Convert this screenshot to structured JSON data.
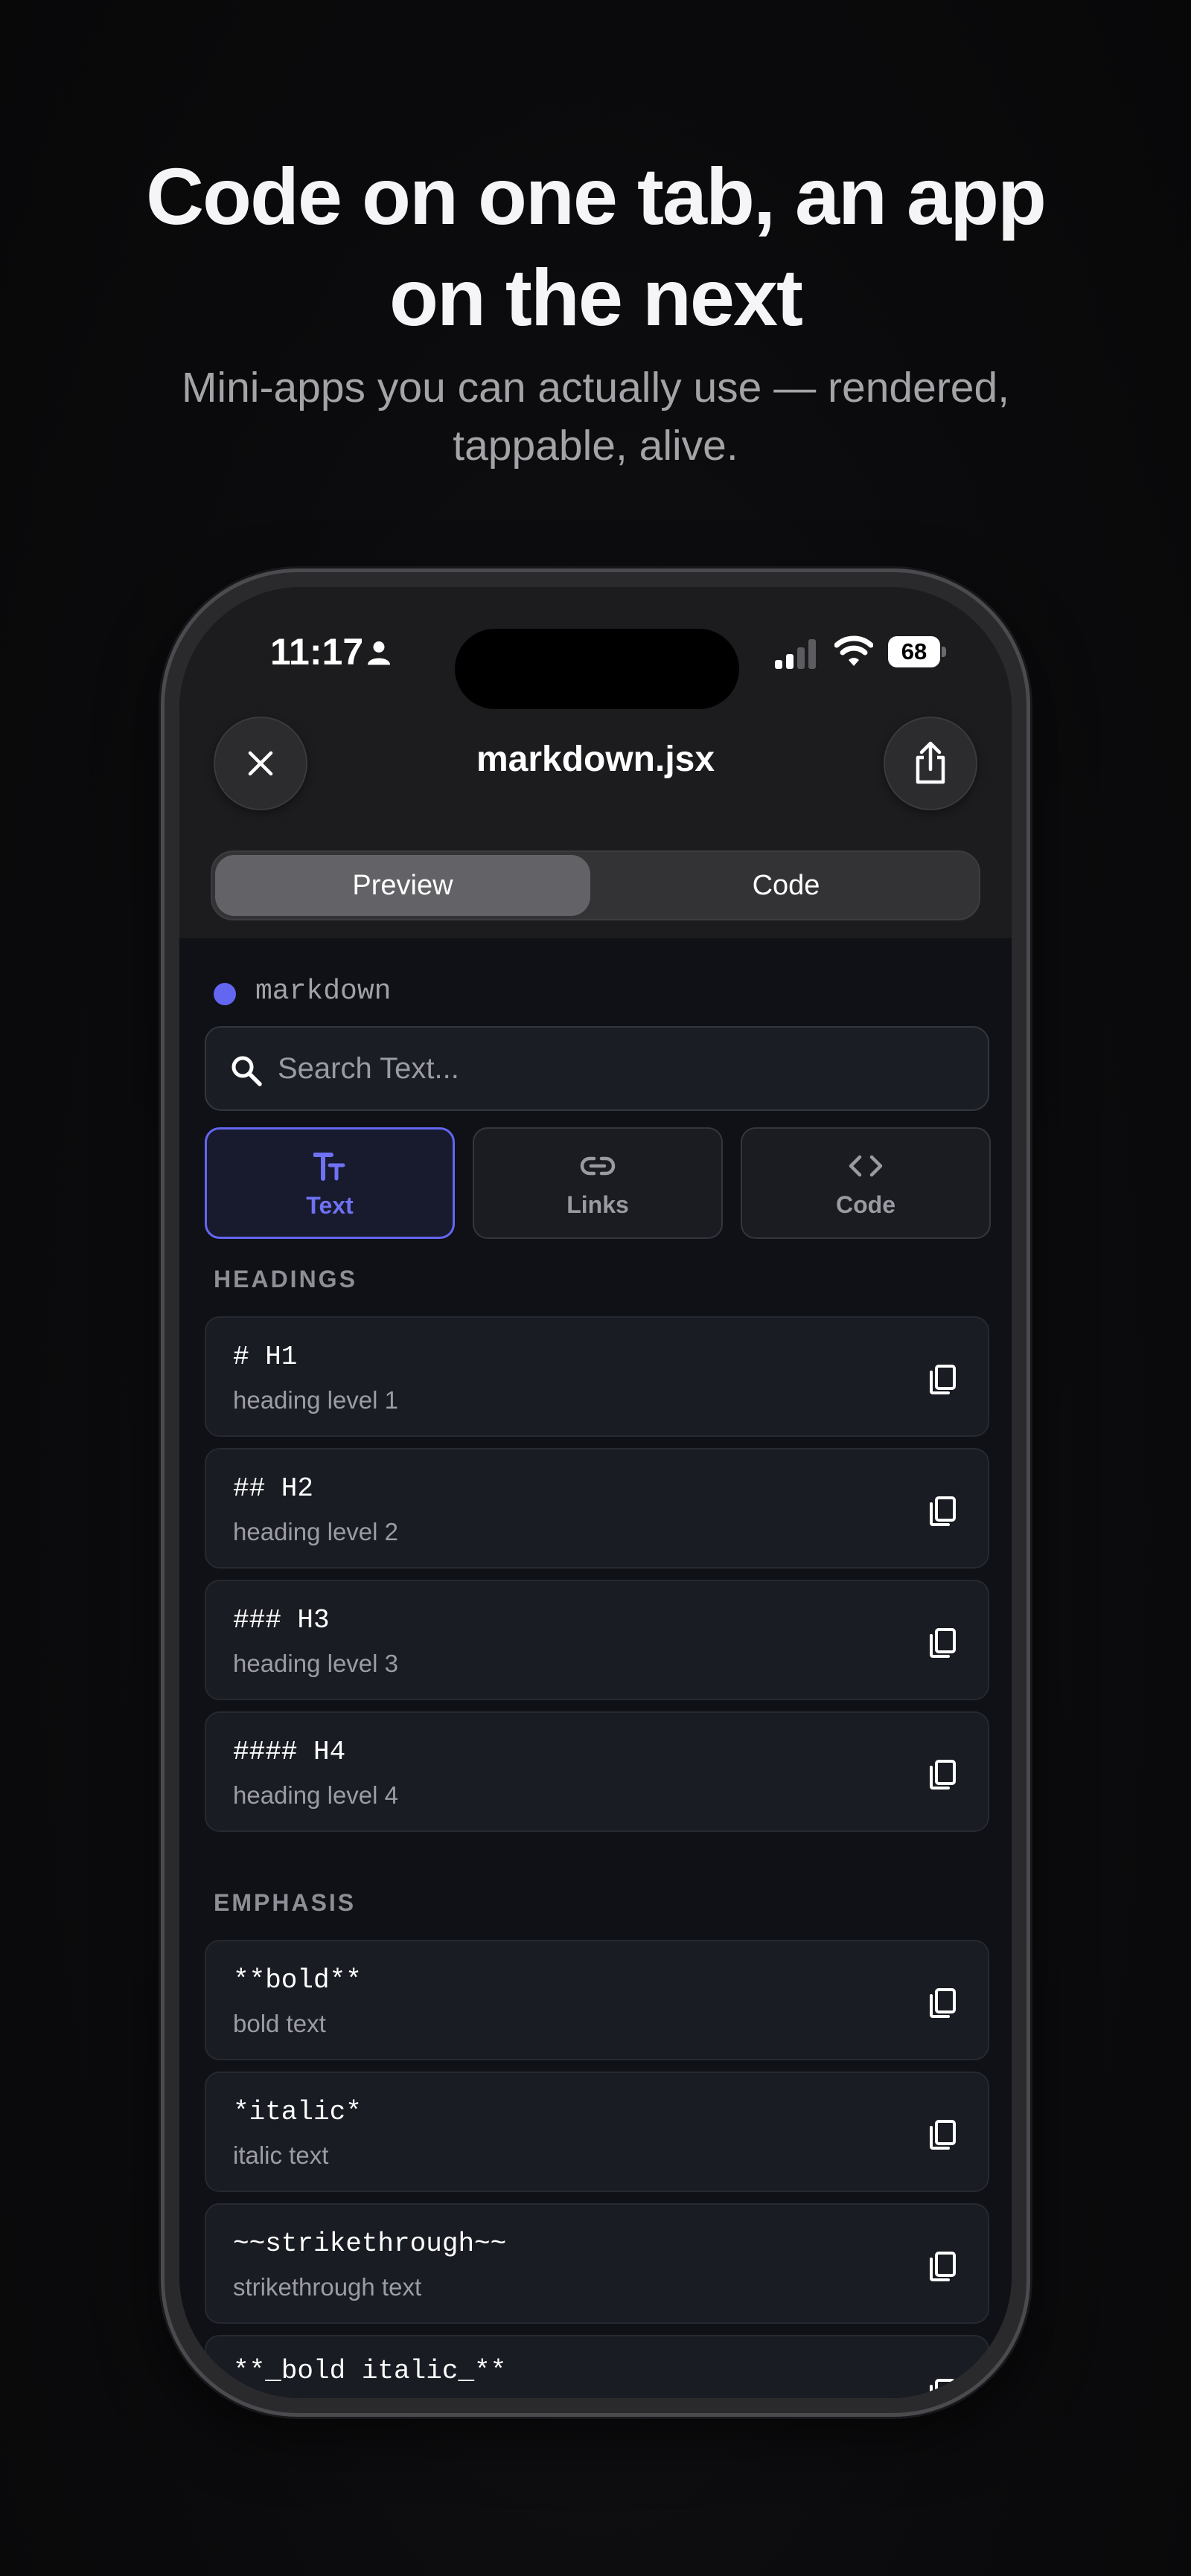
{
  "promo": {
    "headline_line1": "Code on one tab, an app",
    "headline_line2": "on the next",
    "subhead_line1": "Mini-apps you can actually use — rendered,",
    "subhead_line2": "tappable, alive."
  },
  "status_bar": {
    "time": "11:17",
    "battery": "68"
  },
  "header": {
    "title": "markdown.jsx",
    "close_icon": "close-icon",
    "share_icon": "share-icon"
  },
  "segmented": {
    "preview_label": "Preview",
    "code_label": "Code",
    "selected": "Preview"
  },
  "app": {
    "name": "markdown",
    "accent_color": "#6366f1",
    "search_placeholder": "Search Text...",
    "tabs": [
      {
        "label": "Text",
        "icon": "text-size-icon",
        "active": true
      },
      {
        "label": "Links",
        "icon": "link-icon",
        "active": false
      },
      {
        "label": "Code",
        "icon": "code-brackets-icon",
        "active": false
      }
    ],
    "sections": [
      {
        "title": "HEADINGS",
        "items": [
          {
            "syntax": "# H1",
            "description": "heading level 1"
          },
          {
            "syntax": "## H2",
            "description": "heading level 2"
          },
          {
            "syntax": "### H3",
            "description": "heading level 3"
          },
          {
            "syntax": "#### H4",
            "description": "heading level 4"
          }
        ]
      },
      {
        "title": "EMPHASIS",
        "items": [
          {
            "syntax": "**bold**",
            "description": "bold text"
          },
          {
            "syntax": "*italic*",
            "description": "italic text"
          },
          {
            "syntax": "~~strikethrough~~",
            "description": "strikethrough text"
          },
          {
            "syntax": "**_bold italic_**",
            "description": ""
          }
        ]
      }
    ]
  }
}
